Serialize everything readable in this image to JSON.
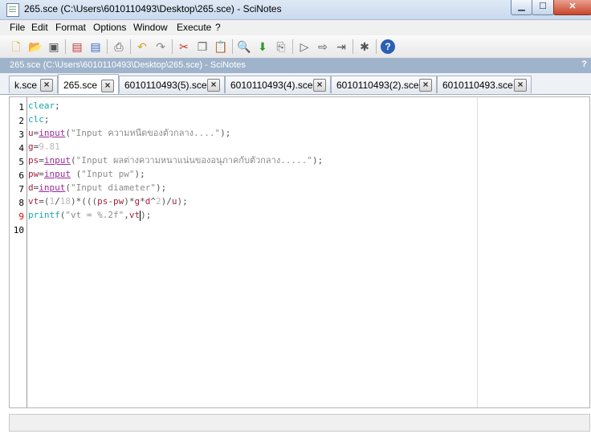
{
  "window": {
    "title": "265.sce (C:\\Users\\6010110493\\Desktop\\265.sce) - SciNotes"
  },
  "menu": [
    "File",
    "Edit",
    "Format",
    "Options",
    "Window",
    "Execute",
    "?"
  ],
  "toolbar": {
    "icons": [
      "new-file-icon",
      "open-file-icon",
      "open-file-in-scinotes-icon",
      "save-icon",
      "save-as-icon",
      "print-icon",
      "undo-icon",
      "redo-icon",
      "cut-icon",
      "copy-icon",
      "paste-icon",
      "find-replace-icon",
      "load-into-scilab-icon",
      "execute-to-console-icon",
      "execute-icon",
      "execute-with-echo-icon",
      "execute-until-caret-icon",
      "preferences-icon",
      "help-icon"
    ]
  },
  "doc_header": {
    "title": "265.sce (C:\\Users\\6010110493\\Desktop\\265.sce) - SciNotes",
    "help": "?"
  },
  "tabs": [
    {
      "label": "k.sce",
      "active": false
    },
    {
      "label": "265.sce",
      "active": true
    },
    {
      "label": "6010110493(5).sce",
      "active": false
    },
    {
      "label": "6010110493(4).sce",
      "active": false
    },
    {
      "label": "6010110493(2).sce",
      "active": false
    },
    {
      "label": "6010110493.sce",
      "active": false
    }
  ],
  "editor": {
    "line_numbers": [
      "1",
      "2",
      "3",
      "4",
      "5",
      "6",
      "7",
      "8",
      "9",
      "10"
    ],
    "current_line": "9",
    "lines": [
      "clear;",
      "clc;",
      "u=input(\"Input ความหนืดของตัวกลาง....\");",
      "g=9.81",
      "ps=input(\"Input ผลต่างความหนาแน่นของอนุภาคกับตัวกลาง.....\");",
      "pw=input (\"Input pw\");",
      "d=input(\"Input diameter\");",
      "vt=(1/18)*(((ps-pw)*g*d^2)/u);",
      "printf(\"vt = %.2f\",vt);",
      ""
    ]
  },
  "colors": {
    "keyword": "#1aa6a6",
    "variable": "#a51f3d",
    "function": "#9b2a9b",
    "string": "#8b8b8b",
    "header_bg": "#9fb3cb"
  }
}
